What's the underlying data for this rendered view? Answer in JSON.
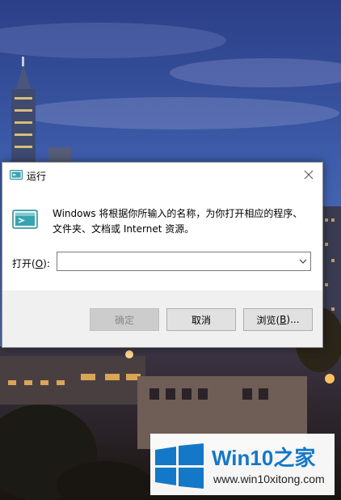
{
  "dialog": {
    "title": "运行",
    "description": "Windows 将根据你所输入的名称，为你打开相应的程序、文件夹、文档或 Internet 资源。",
    "open_label_prefix": "打开(",
    "open_label_key": "O",
    "open_label_suffix": "):",
    "open_value": "",
    "ok_label": "确定",
    "cancel_label": "取消",
    "browse_label_prefix": "浏览(",
    "browse_label_key": "B",
    "browse_label_suffix": ")..."
  },
  "watermark": {
    "title_main": "Win10",
    "title_accent": "之家",
    "url": "www.win10xitong.com",
    "logo_color": "#1378c8"
  }
}
